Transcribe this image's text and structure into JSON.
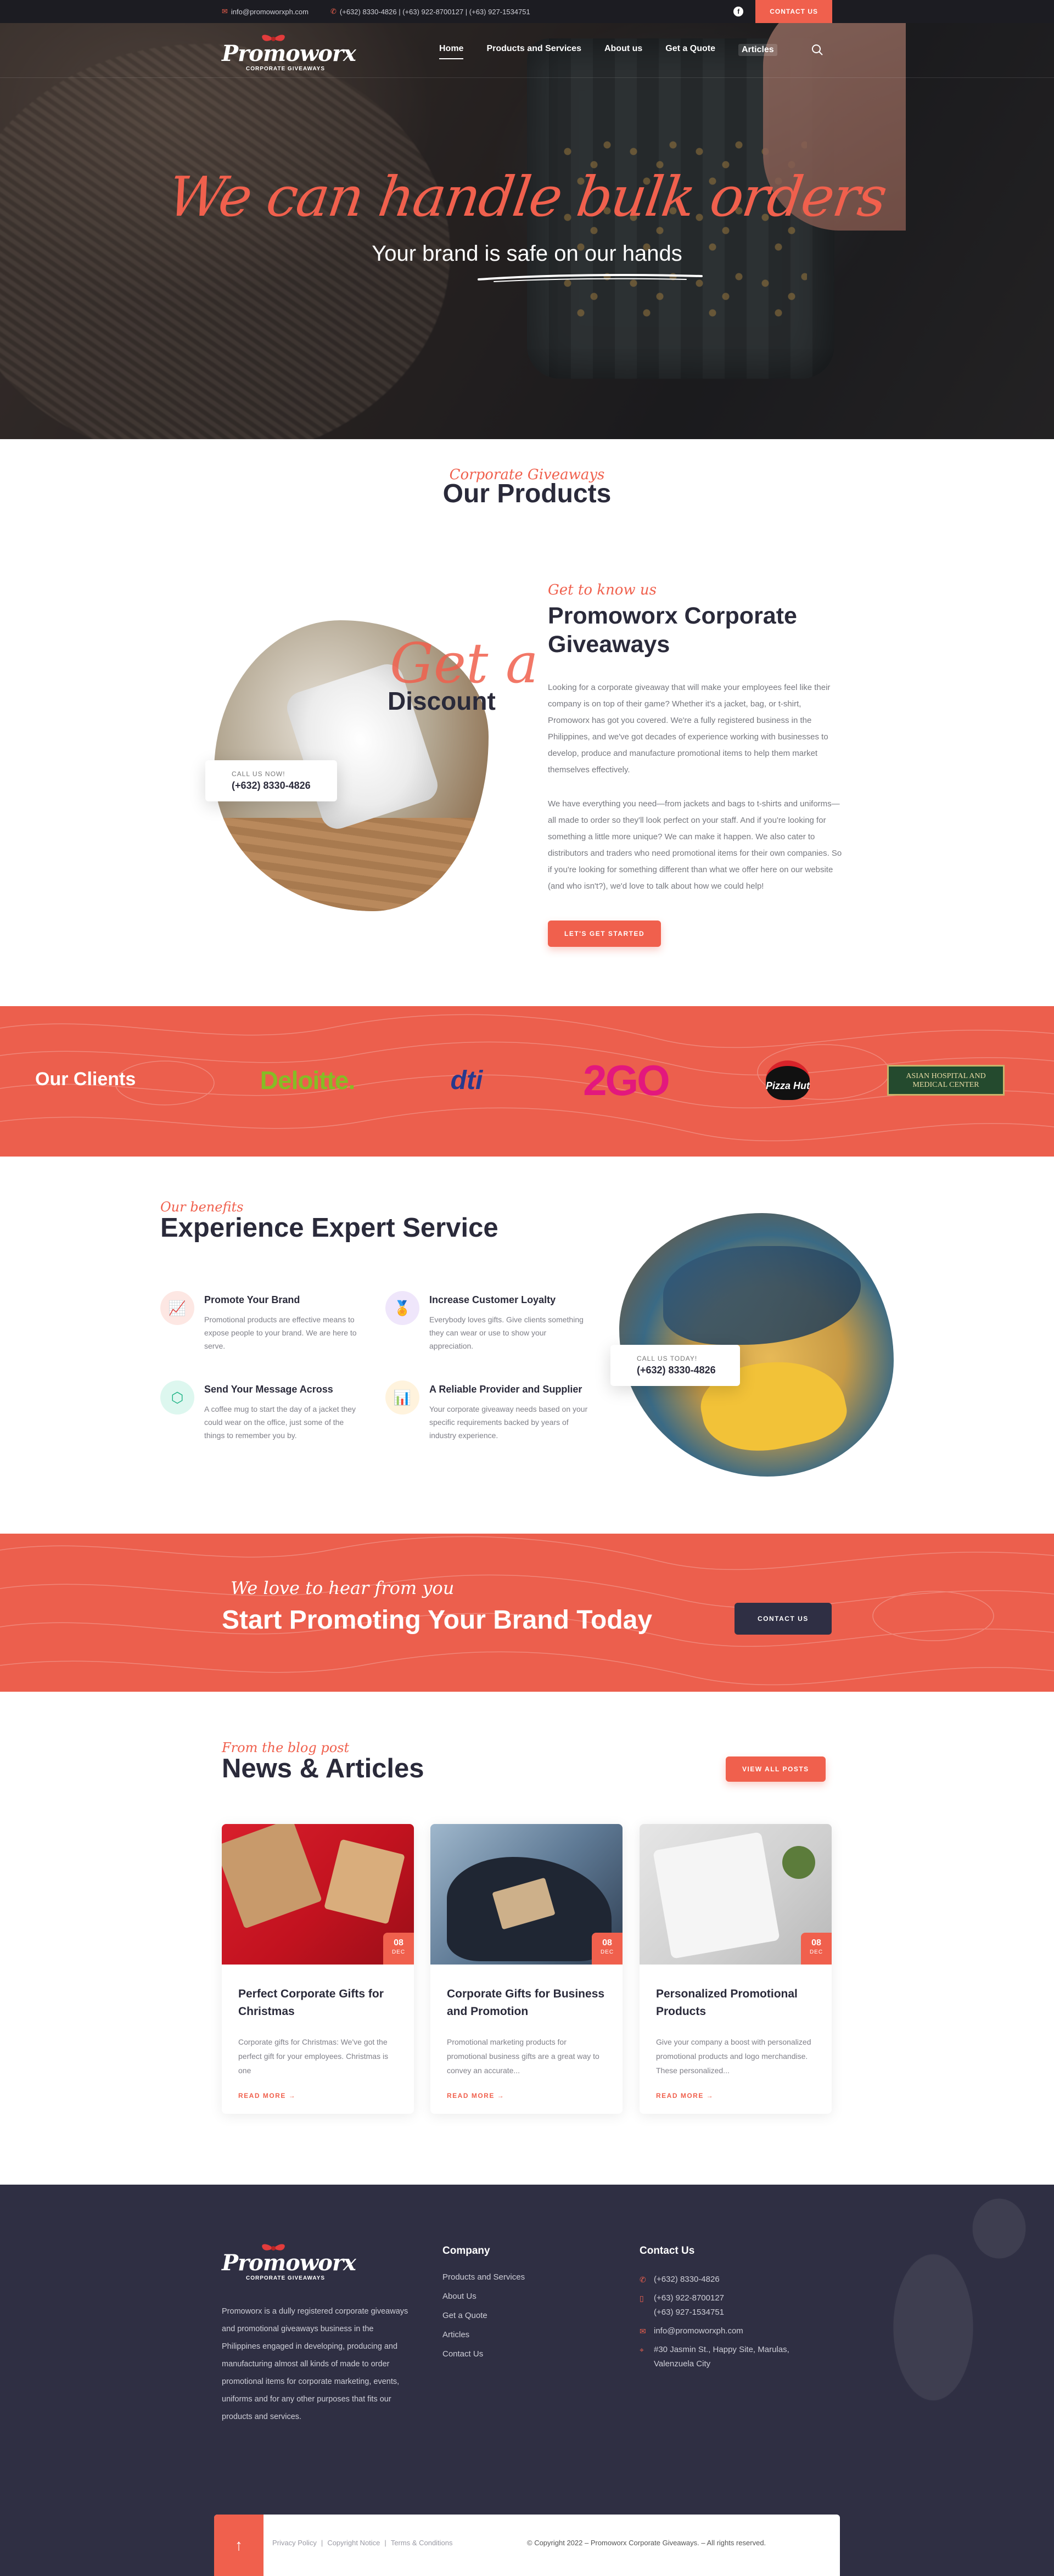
{
  "topbar": {
    "email": "info@promoworxph.com",
    "phones": "(+632) 8330-4826 | (+63) 922-8700127 | (+63) 927-1534751",
    "contact_button": "Contact Us"
  },
  "nav": {
    "logo_text": "Promoworx",
    "logo_sub": "CORPORATE GIVEAWAYS",
    "items": [
      "Home",
      "Products and Services",
      "About us",
      "Get a Quote",
      "Articles"
    ]
  },
  "hero": {
    "script": "We can handle bulk orders",
    "subtitle": "Your brand is safe on our hands"
  },
  "products": {
    "script": "Corporate Giveaways",
    "title": "Our Products"
  },
  "about": {
    "image_script": "Get a",
    "image_title": "Discount",
    "call_label": "Call us now!",
    "call_number": "(+632) 8330-4826",
    "script": "Get to know us",
    "title": "Promoworx Corporate Giveaways",
    "paragraph1": "Looking for a corporate giveaway that will make your employees feel like their company is on top of their game? Whether it's a jacket, bag, or t-shirt, Promoworx has got you covered. We're a fully registered business in the Philippines, and we've got decades of experience working with businesses to develop, produce and manufacture promotional items to help them market themselves effectively.",
    "paragraph2": "We have everything you need—from jackets and bags to t-shirts and uniforms—all made to order so they'll look perfect on your staff. And if you're looking for something a little more unique? We can make it happen. We also cater to distributors and traders who need promotional items for their own companies. So if you're looking for something different than what we offer here on our website (and who isn't?), we'd love to talk about how we could help!",
    "button": "Let's Get Started"
  },
  "clients": {
    "title": "Our Clients",
    "logos": {
      "deloitte": "Deloitte",
      "dti": "dti",
      "togo": "2GO",
      "pizzahut": "Pizza Hut",
      "asian": "ASIAN HOSPITAL AND MEDICAL CENTER"
    }
  },
  "expert": {
    "script": "Our benefits",
    "title": "Experience Expert Service",
    "features": [
      {
        "title": "Promote Your Brand",
        "text": "Promotional products are effective means to expose people to your brand. We are here to serve."
      },
      {
        "title": "Increase Customer Loyalty",
        "text": "Everybody loves gifts. Give clients something they can wear or use to show your appreciation."
      },
      {
        "title": "Send Your Message Across",
        "text": "A coffee mug to start the day of a jacket they could wear on the office, just some of the things to remember you by."
      },
      {
        "title": "A Reliable Provider and Supplier",
        "text": "Your corporate giveaway needs based on your specific requirements backed by years of industry experience."
      }
    ],
    "call_label": "Call us today!",
    "call_number": "(+632) 8330-4826"
  },
  "cta": {
    "script": "We love to hear from you",
    "title": "Start Promoting Your Brand Today",
    "button": "Contact Us"
  },
  "news": {
    "script": "From the blog post",
    "title": "News & Articles",
    "button": "View All Posts",
    "read_more": "Read More →",
    "cards": [
      {
        "title": "Perfect Corporate Gifts for Christmas",
        "text": "Corporate gifts for Christmas: We've got the perfect gift for your employees. Christmas is one",
        "day": "08",
        "month": "DEC"
      },
      {
        "title": "Corporate Gifts for Business and Promotion",
        "text": "Promotional marketing products for promotional business gifts are a great way to convey an accurate...",
        "day": "08",
        "month": "DEC"
      },
      {
        "title": "Personalized Promotional Products",
        "text": "Give your company a boost with personalized promotional products and logo merchandise. These personalized...",
        "day": "08",
        "month": "DEC"
      }
    ]
  },
  "footer": {
    "about": "Promoworx is a dully registered corporate giveaways and promotional giveaways business in the Philippines engaged in developing, producing and manufacturing almost all kinds of made to order promotional items for corporate marketing, events, uniforms and for any other purposes that fits our products and services.",
    "company_title": "Company",
    "company_links": [
      "Products and Services",
      "About Us",
      "Get a Quote",
      "Articles",
      "Contact Us"
    ],
    "contact_title": "Contact Us",
    "contacts": {
      "phone1": "(+632) 8330-4826",
      "phone2": "(+63) 922-8700127",
      "phone3": "(+63) 927-1534751",
      "email": "info@promoworxph.com",
      "address": "#30 Jasmin St., Happy Site, Marulas, Valenzuela City"
    },
    "legal": [
      "Privacy Policy",
      "Copyright Notice",
      "Terms & Conditions"
    ],
    "copyright": "© Copyright 2022 – Promoworx Corporate Giveaways. – All rights reserved."
  },
  "colors": {
    "accent": "#f0604d",
    "dark": "#2f2f43",
    "text": "#2a2a3a"
  }
}
